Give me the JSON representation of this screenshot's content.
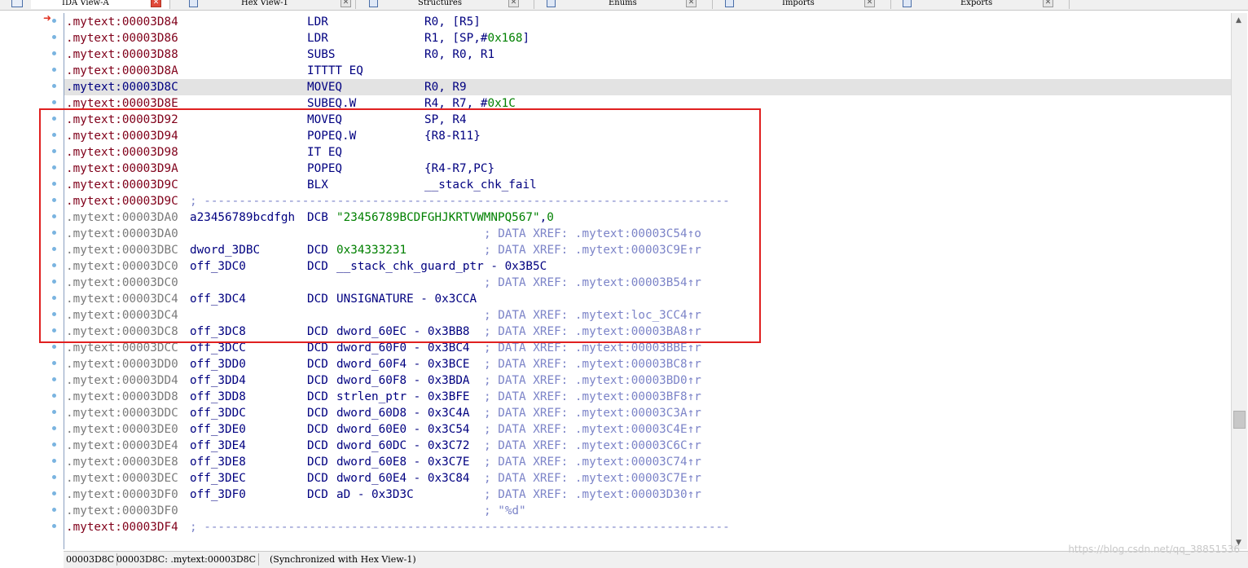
{
  "tabs": [
    {
      "label": "IDA View-A",
      "icon": "ida-view-icon",
      "active": true
    },
    {
      "label": "Hex View-1",
      "icon": "hex-view-icon",
      "active": false
    },
    {
      "label": "Structures",
      "icon": "structures-icon",
      "active": false
    },
    {
      "label": "Enums",
      "icon": "enums-icon",
      "active": false
    },
    {
      "label": "Imports",
      "icon": "imports-icon",
      "active": false
    },
    {
      "label": "Exports",
      "icon": "exports-icon",
      "active": false
    }
  ],
  "colors": {
    "code_address": "#80001a",
    "data_address": "#7a7a7a",
    "instruction": "#000080",
    "number": "#008000",
    "comment": "#7c84c8",
    "selected_line": "#e3e3e3",
    "highlight_box": "#e02020",
    "gutter_dot": "#7ab4e0"
  },
  "lines": [
    {
      "addr": ".mytext:00003D84",
      "kind": "code",
      "label": "",
      "mnemonic": "LDR",
      "operands": [
        {
          "t": "R0, [R5]",
          "k": "op"
        }
      ],
      "comment": ""
    },
    {
      "addr": ".mytext:00003D86",
      "kind": "code",
      "label": "",
      "mnemonic": "LDR",
      "operands": [
        {
          "t": "R1, [SP,#",
          "k": "op"
        },
        {
          "t": "0x168",
          "k": "num"
        },
        {
          "t": "]",
          "k": "op"
        }
      ],
      "comment": ""
    },
    {
      "addr": ".mytext:00003D88",
      "kind": "code",
      "label": "",
      "mnemonic": "SUBS",
      "operands": [
        {
          "t": "R0, R0, R1",
          "k": "op"
        }
      ],
      "comment": ""
    },
    {
      "addr": ".mytext:00003D8A",
      "kind": "code",
      "label": "",
      "mnemonic": "ITTTT EQ",
      "operands": [],
      "comment": ""
    },
    {
      "addr": ".mytext:00003D8C",
      "kind": "sel",
      "label": "",
      "mnemonic": "MOVEQ",
      "operands": [
        {
          "t": "R0, R9",
          "k": "op"
        }
      ],
      "comment": ""
    },
    {
      "addr": ".mytext:00003D8E",
      "kind": "code",
      "label": "",
      "mnemonic": "SUBEQ.W",
      "operands": [
        {
          "t": "R4, R7, #",
          "k": "op"
        },
        {
          "t": "0x1C",
          "k": "num"
        }
      ],
      "comment": ""
    },
    {
      "addr": ".mytext:00003D92",
      "kind": "code",
      "label": "",
      "mnemonic": "MOVEQ",
      "operands": [
        {
          "t": "SP, R4",
          "k": "op"
        }
      ],
      "comment": ""
    },
    {
      "addr": ".mytext:00003D94",
      "kind": "code",
      "label": "",
      "mnemonic": "POPEQ.W",
      "operands": [
        {
          "t": "{R8-R11}",
          "k": "op"
        }
      ],
      "comment": ""
    },
    {
      "addr": ".mytext:00003D98",
      "kind": "code",
      "label": "",
      "mnemonic": "IT EQ",
      "operands": [],
      "comment": ""
    },
    {
      "addr": ".mytext:00003D9A",
      "kind": "code",
      "label": "",
      "mnemonic": "POPEQ",
      "operands": [
        {
          "t": "{R4-R7,PC}",
          "k": "op"
        }
      ],
      "comment": ""
    },
    {
      "addr": ".mytext:00003D9C",
      "kind": "code",
      "label": "",
      "mnemonic": "BLX",
      "operands": [
        {
          "t": "__stack_chk_fail",
          "k": "op"
        }
      ],
      "comment": ""
    },
    {
      "addr": ".mytext:00003D9C",
      "kind": "code-sep",
      "label": "",
      "mnemonic": "",
      "operands": [],
      "comment": "; ---------------------------------------------------------------------------"
    },
    {
      "addr": ".mytext:00003DA0",
      "kind": "data",
      "label": "a23456789bcdfgh",
      "mnemonic": "DCB",
      "operands": [
        {
          "t": "\"23456789BCDFGHJKRTVWMNPQ567\"",
          "k": "str"
        },
        {
          "t": ",",
          "k": "op"
        },
        {
          "t": "0",
          "k": "num"
        }
      ],
      "comment": ""
    },
    {
      "addr": ".mytext:00003DA0",
      "kind": "data",
      "label": "",
      "mnemonic": "",
      "operands": [],
      "comment": "; DATA XREF: .mytext:00003C54↑o"
    },
    {
      "addr": ".mytext:00003DBC",
      "kind": "data",
      "label": "dword_3DBC",
      "mnemonic": "DCD",
      "operands": [
        {
          "t": "0x34333231",
          "k": "num"
        }
      ],
      "comment": "; DATA XREF: .mytext:00003C9E↑r"
    },
    {
      "addr": ".mytext:00003DC0",
      "kind": "data",
      "label": "off_3DC0",
      "mnemonic": "DCD",
      "operands": [
        {
          "t": "__stack_chk_guard_ptr - 0x3B5C",
          "k": "op"
        }
      ],
      "comment": ""
    },
    {
      "addr": ".mytext:00003DC0",
      "kind": "data",
      "label": "",
      "mnemonic": "",
      "operands": [],
      "comment": "; DATA XREF: .mytext:00003B54↑r"
    },
    {
      "addr": ".mytext:00003DC4",
      "kind": "data",
      "label": "off_3DC4",
      "mnemonic": "DCD",
      "operands": [
        {
          "t": "UNSIGNATURE - 0x3CCA",
          "k": "op"
        }
      ],
      "comment": ""
    },
    {
      "addr": ".mytext:00003DC4",
      "kind": "data",
      "label": "",
      "mnemonic": "",
      "operands": [],
      "comment": "; DATA XREF: .mytext:loc_3CC4↑r"
    },
    {
      "addr": ".mytext:00003DC8",
      "kind": "data",
      "label": "off_3DC8",
      "mnemonic": "DCD",
      "operands": [
        {
          "t": "dword_60EC - 0x3BB8",
          "k": "op"
        }
      ],
      "comment": "; DATA XREF: .mytext:00003BA8↑r"
    },
    {
      "addr": ".mytext:00003DCC",
      "kind": "data",
      "label": "off_3DCC",
      "mnemonic": "DCD",
      "operands": [
        {
          "t": "dword_60F0 - 0x3BC4",
          "k": "op"
        }
      ],
      "comment": "; DATA XREF: .mytext:00003BBE↑r"
    },
    {
      "addr": ".mytext:00003DD0",
      "kind": "data",
      "label": "off_3DD0",
      "mnemonic": "DCD",
      "operands": [
        {
          "t": "dword_60F4 - 0x3BCE",
          "k": "op"
        }
      ],
      "comment": "; DATA XREF: .mytext:00003BC8↑r"
    },
    {
      "addr": ".mytext:00003DD4",
      "kind": "data",
      "label": "off_3DD4",
      "mnemonic": "DCD",
      "operands": [
        {
          "t": "dword_60F8 - 0x3BDA",
          "k": "op"
        }
      ],
      "comment": "; DATA XREF: .mytext:00003BD0↑r"
    },
    {
      "addr": ".mytext:00003DD8",
      "kind": "data",
      "label": "off_3DD8",
      "mnemonic": "DCD",
      "operands": [
        {
          "t": "strlen_ptr - 0x3BFE",
          "k": "op"
        }
      ],
      "comment": "; DATA XREF: .mytext:00003BF8↑r"
    },
    {
      "addr": ".mytext:00003DDC",
      "kind": "data",
      "label": "off_3DDC",
      "mnemonic": "DCD",
      "operands": [
        {
          "t": "dword_60D8 - 0x3C4A",
          "k": "op"
        }
      ],
      "comment": "; DATA XREF: .mytext:00003C3A↑r"
    },
    {
      "addr": ".mytext:00003DE0",
      "kind": "data",
      "label": "off_3DE0",
      "mnemonic": "DCD",
      "operands": [
        {
          "t": "dword_60E0 - 0x3C54",
          "k": "op"
        }
      ],
      "comment": "; DATA XREF: .mytext:00003C4E↑r"
    },
    {
      "addr": ".mytext:00003DE4",
      "kind": "data",
      "label": "off_3DE4",
      "mnemonic": "DCD",
      "operands": [
        {
          "t": "dword_60DC - 0x3C72",
          "k": "op"
        }
      ],
      "comment": "; DATA XREF: .mytext:00003C6C↑r"
    },
    {
      "addr": ".mytext:00003DE8",
      "kind": "data",
      "label": "off_3DE8",
      "mnemonic": "DCD",
      "operands": [
        {
          "t": "dword_60E8 - 0x3C7E",
          "k": "op"
        }
      ],
      "comment": "; DATA XREF: .mytext:00003C74↑r"
    },
    {
      "addr": ".mytext:00003DEC",
      "kind": "data",
      "label": "off_3DEC",
      "mnemonic": "DCD",
      "operands": [
        {
          "t": "dword_60E4 - 0x3C84",
          "k": "op"
        }
      ],
      "comment": "; DATA XREF: .mytext:00003C7E↑r"
    },
    {
      "addr": ".mytext:00003DF0",
      "kind": "data",
      "label": "off_3DF0",
      "mnemonic": "DCD",
      "operands": [
        {
          "t": "aD - 0x3D3C",
          "k": "op"
        }
      ],
      "comment": "; DATA XREF: .mytext:00003D30↑r"
    },
    {
      "addr": ".mytext:00003DF0",
      "kind": "data",
      "label": "",
      "mnemonic": "",
      "operands": [],
      "comment": "; \"%d\""
    },
    {
      "addr": ".mytext:00003DF4",
      "kind": "code-sep",
      "label": "",
      "mnemonic": "",
      "operands": [],
      "comment": "; ---------------------------------------------------------------------------"
    }
  ],
  "status": {
    "offset": "00003D8C",
    "location": "00003D8C: .mytext:00003D8C",
    "sync": "(Synchronized with Hex View-1)"
  },
  "watermark": "https://blog.csdn.net/qq_38851536"
}
